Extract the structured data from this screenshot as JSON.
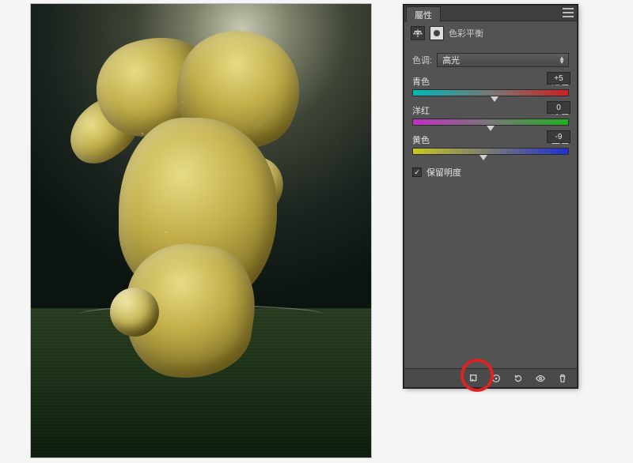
{
  "panel": {
    "tab_label": "屬性",
    "title": "色彩平衡",
    "tone_label": "色调:",
    "tone_value": "高光",
    "sliders": [
      {
        "left": "青色",
        "right": "红色",
        "value": "+5",
        "pos": 52.5
      },
      {
        "left": "洋红",
        "right": "绿色",
        "value": "0",
        "pos": 50
      },
      {
        "left": "黄色",
        "right": "蓝色",
        "value": "-9",
        "pos": 45.5
      }
    ],
    "preserve_luminosity": "保留明度"
  }
}
